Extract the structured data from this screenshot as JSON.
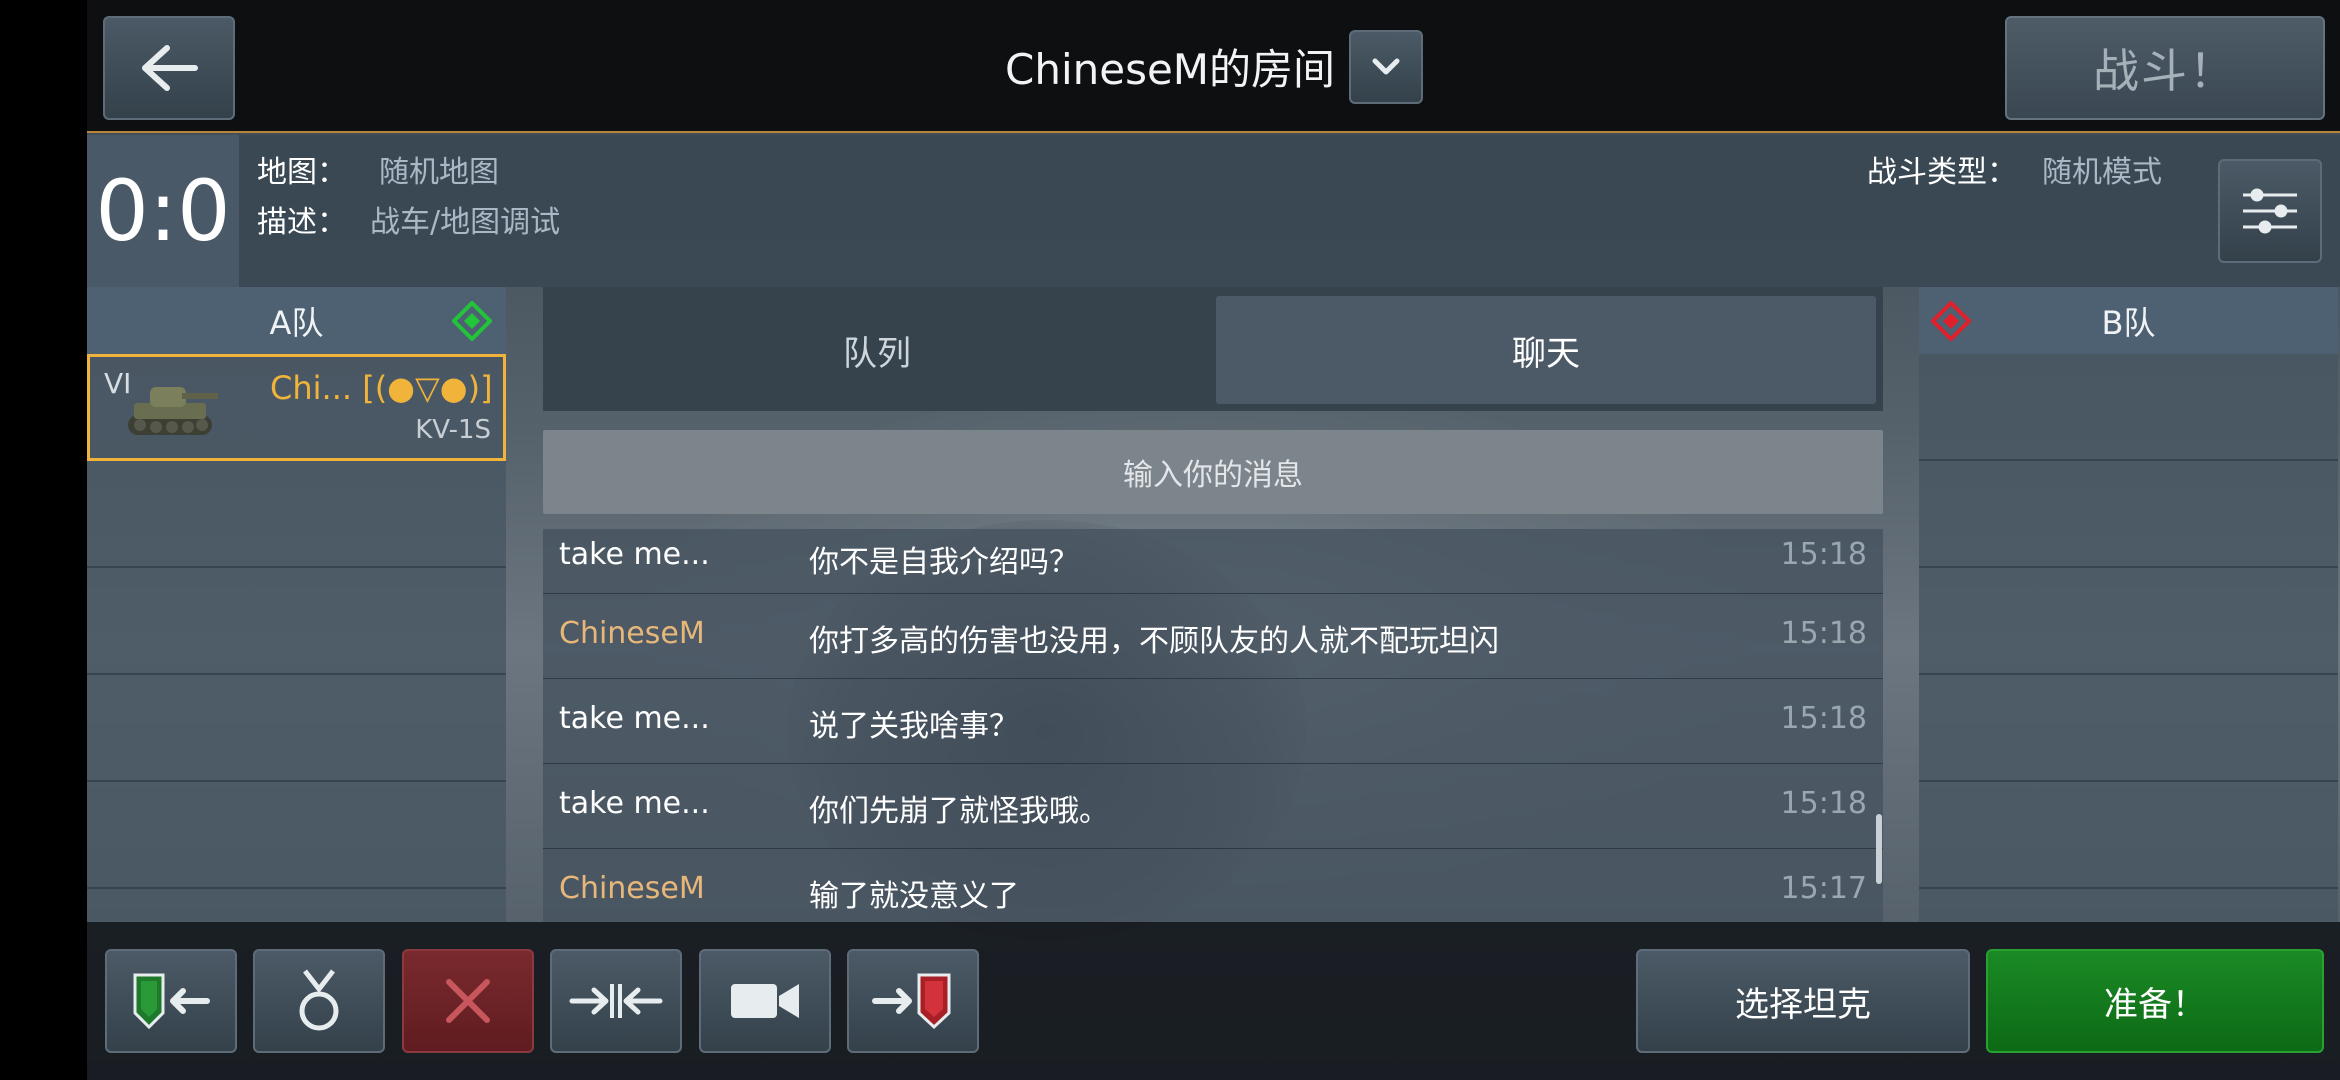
{
  "header": {
    "room_title": "ChineseM的房间",
    "battle_label": "战斗！"
  },
  "info": {
    "score": "0:0",
    "map_label": "地图：",
    "map_value": "随机地图",
    "desc_label": "描述：",
    "desc_value": "战车/地图调试",
    "battle_type_label": "战斗类型：",
    "battle_type_value": "随机模式"
  },
  "team_a": {
    "name": "A队",
    "color": "#22c43a",
    "slots": [
      {
        "tier": "VI",
        "player": "Chi... [(●▽●)]",
        "tank": "KV-1S"
      }
    ]
  },
  "team_b": {
    "name": "B队",
    "color": "#e0202a"
  },
  "tabs": {
    "queue": "队列",
    "chat": "聊天",
    "active": "chat"
  },
  "chat": {
    "input_placeholder": "输入你的消息",
    "messages": [
      {
        "name": "take  me...",
        "text": "你不是自我介绍吗？",
        "time": "15:18"
      },
      {
        "name": "ChineseM",
        "text": "你打多高的伤害也没用，不顾队友的人就不配玩坦闪",
        "time": "15:18"
      },
      {
        "name": "take  me...",
        "text": "说了关我啥事？",
        "time": "15:18"
      },
      {
        "name": "take  me...",
        "text": "你们先崩了就怪我哦。",
        "time": "15:18"
      },
      {
        "name": "ChineseM",
        "text": "输了就没意义了",
        "time": "15:17"
      }
    ]
  },
  "bottom": {
    "select_tank": "选择坦克",
    "ready": "准备！"
  },
  "colors": {
    "accent": "#f0b43a",
    "ready": "#1a8a24"
  },
  "icons": [
    "back-arrow-icon",
    "chevron-down-icon",
    "filter-sliders-icon",
    "join-team-a-icon",
    "medal-icon",
    "close-icon",
    "merge-arrows-icon",
    "camera-icon",
    "join-team-b-icon"
  ]
}
